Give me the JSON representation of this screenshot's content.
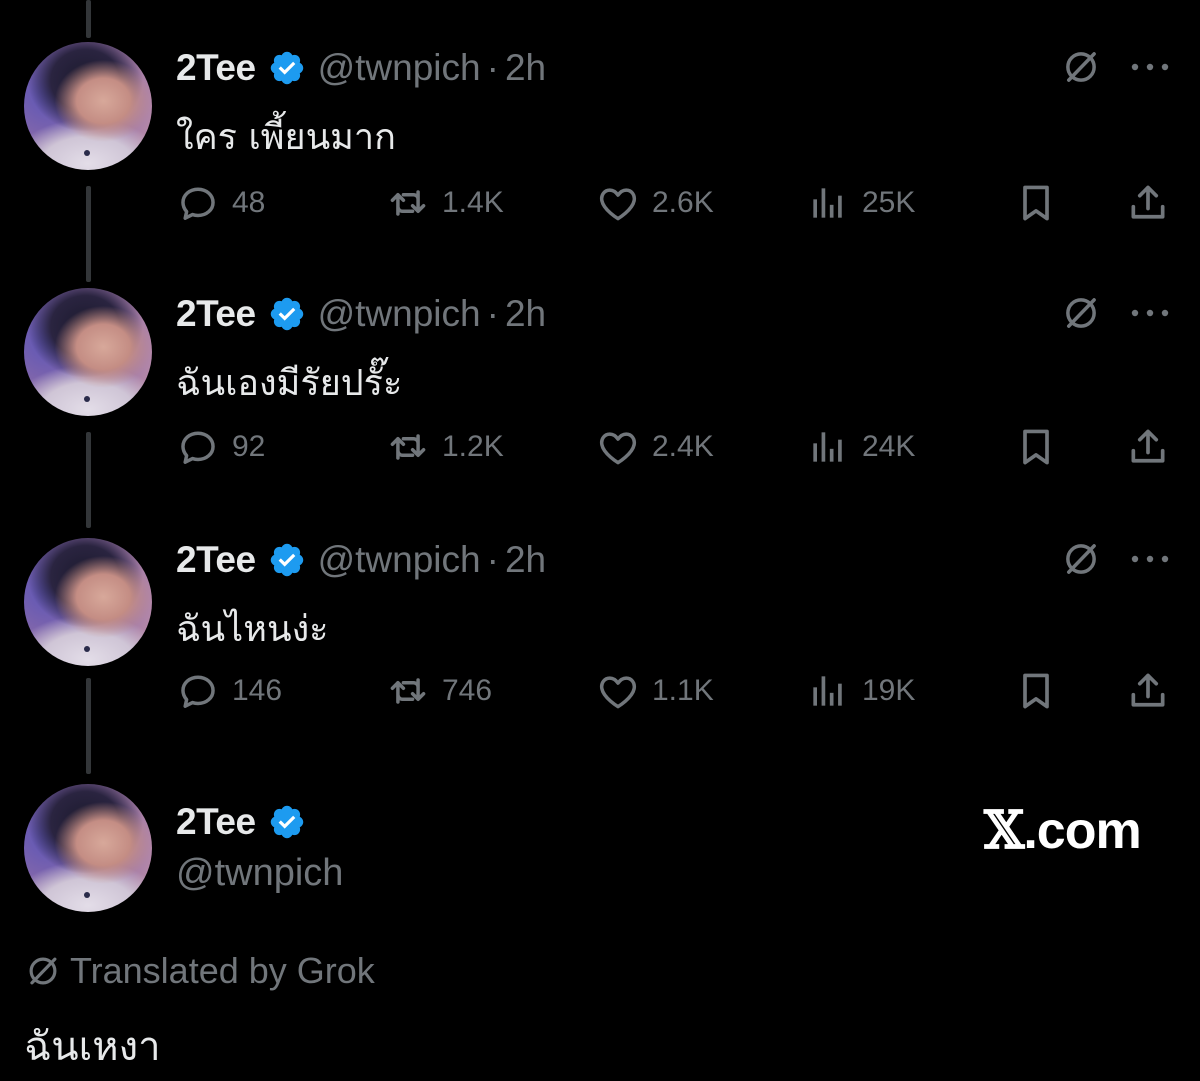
{
  "colors": {
    "background": "#000000",
    "text": "#e7e9ea",
    "muted": "#71767b",
    "verified": "#1d9bf0",
    "thread_line": "#333639"
  },
  "tweets": [
    {
      "name": "2Tee",
      "handle": "@twnpich",
      "separator": "·",
      "time": "2h",
      "text": "ใคร เพี้ยนมาก",
      "replies": "48",
      "reposts": "1.4K",
      "likes": "2.6K",
      "views": "25K"
    },
    {
      "name": "2Tee",
      "handle": "@twnpich",
      "separator": "·",
      "time": "2h",
      "text": "ฉันเองมีรัยปรั๊ะ",
      "replies": "92",
      "reposts": "1.2K",
      "likes": "2.4K",
      "views": "24K"
    },
    {
      "name": "2Tee",
      "handle": "@twnpich",
      "separator": "·",
      "time": "2h",
      "text": "ฉันไหนง่ะ",
      "replies": "146",
      "reposts": "746",
      "likes": "1.1K",
      "views": "19K"
    }
  ],
  "final": {
    "name": "2Tee",
    "handle": "@twnpich",
    "brand_x": "𝕏",
    "brand_suffix": ".com",
    "translated_label": "Translated by Grok",
    "translation": "ฉันเหงา"
  },
  "icons": [
    "grok-icon",
    "more-icon",
    "reply-icon",
    "repost-icon",
    "like-icon",
    "views-icon",
    "bookmark-icon",
    "share-icon",
    "verified-badge-icon"
  ]
}
